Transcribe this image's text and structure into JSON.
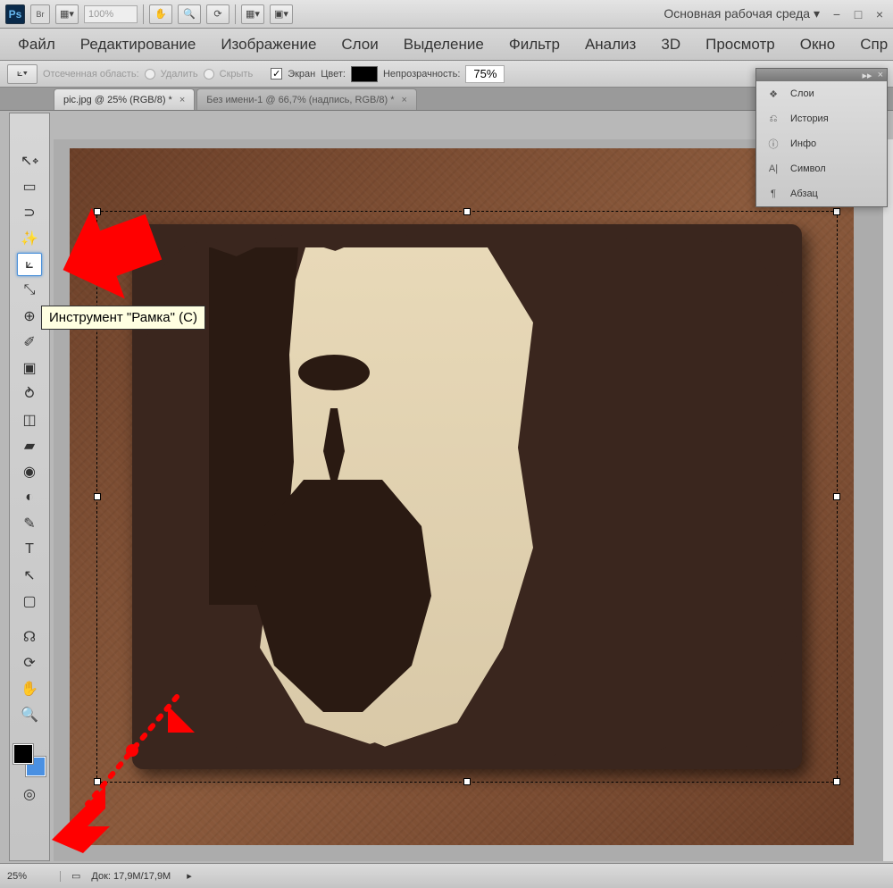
{
  "topbar": {
    "ps": "Ps",
    "br": "Br",
    "zoom": "100%",
    "workspace": "Основная рабочая среда ▾"
  },
  "win": {
    "min": "−",
    "max": "□",
    "close": "×"
  },
  "menu": [
    "Файл",
    "Редактирование",
    "Изображение",
    "Слои",
    "Выделение",
    "Фильтр",
    "Анализ",
    "3D",
    "Просмотр",
    "Окно",
    "Спра"
  ],
  "options": {
    "crop_label": "Отсеченная область:",
    "delete": "Удалить",
    "hide": "Скрыть",
    "screen": "Экран",
    "color": "Цвет:",
    "opacity": "Непрозрачность:",
    "opacity_val": "75%"
  },
  "tabs": [
    {
      "label": "pic.jpg @ 25% (RGB/8) *",
      "active": true
    },
    {
      "label": "Без имени-1 @ 66,7% (надпись, RGB/8) *",
      "active": false
    }
  ],
  "panel": {
    "items": [
      "Слои",
      "История",
      "Инфо",
      "Символ",
      "Абзац"
    ]
  },
  "status": {
    "zoom": "25%",
    "doc": "Док: 17,9M/17,9M"
  },
  "tooltip": "Инструмент \"Рамка\" (C)",
  "tools": [
    "↖",
    "▭",
    "⊡",
    "✎",
    "✂",
    "👁",
    "✨",
    "⌇",
    "▣",
    "◔",
    "✐",
    "⌫",
    "▰",
    "◉",
    "◐",
    "T",
    "✎",
    "▢",
    "☊",
    "⟳",
    "✋",
    "🔍"
  ]
}
